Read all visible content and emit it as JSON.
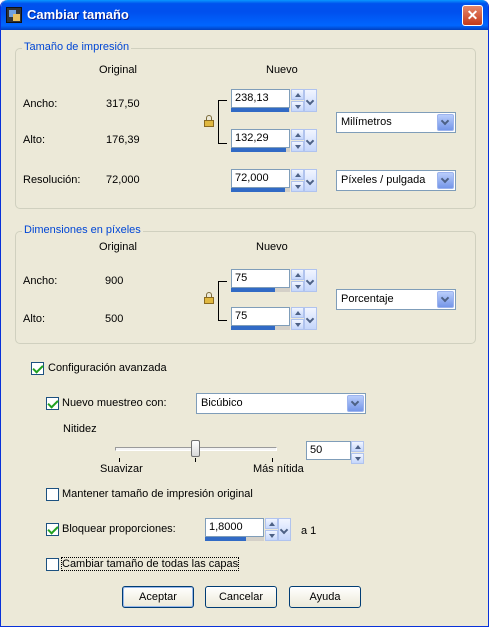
{
  "window": {
    "title": "Cambiar tamaño"
  },
  "print_size": {
    "group_title": "Tamaño de impresión",
    "col_original": "Original",
    "col_new": "Nuevo",
    "width_label": "Ancho:",
    "width_original": "317,50",
    "width_new": "238,13",
    "width_new_fill": 0.98,
    "height_label": "Alto:",
    "height_original": "176,39",
    "height_new": "132,29",
    "height_new_fill": 0.93,
    "resolution_label": "Resolución:",
    "resolution_original": "72,000",
    "resolution_new": "72,000",
    "resolution_new_fill": 0.92,
    "unit": "Milímetros",
    "resolution_unit": "Píxeles / pulgada"
  },
  "pixel_dims": {
    "group_title": "Dimensiones en píxeles",
    "col_original": "Original",
    "col_new": "Nuevo",
    "width_label": "Ancho:",
    "width_original": "900",
    "width_new": "75",
    "width_new_fill": 0.75,
    "height_label": "Alto:",
    "height_original": "500",
    "height_new": "75",
    "height_new_fill": 0.75,
    "unit": "Porcentaje"
  },
  "advanced": {
    "label": "Configuración avanzada",
    "checked": true,
    "resample_label": "Nuevo muestreo con:",
    "resample_checked": true,
    "resample_method": "Bicúbico",
    "sharpness_label": "Nitidez",
    "slider_value": 0.5,
    "soften_label": "Suavizar",
    "sharper_label": "Más nítida",
    "sharpness_value": "50",
    "keep_print_size_label": "Mantener tamaño de impresión original",
    "keep_print_size_checked": false,
    "lock_ratio_label": "Bloquear proporciones:",
    "lock_ratio_checked": true,
    "ratio_value": "1,8000",
    "ratio_fill": 0.7,
    "ratio_suffix": "a 1",
    "all_layers_label": "Cambiar tamaño de todas las capas",
    "all_layers_checked": false
  },
  "buttons": {
    "ok": "Aceptar",
    "cancel": "Cancelar",
    "help": "Ayuda"
  }
}
